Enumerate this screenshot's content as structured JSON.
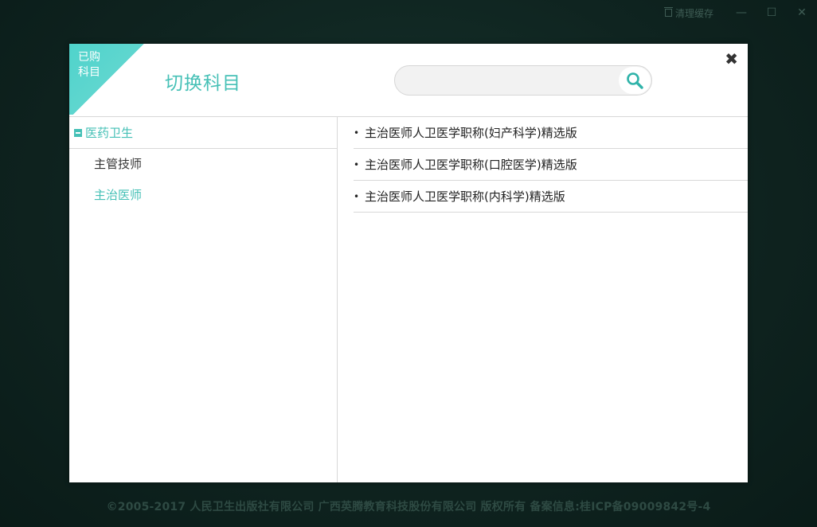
{
  "titlebar": {
    "clear_cache_label": "清理缓存",
    "minimize_glyph": "—",
    "maximize_glyph": "☐",
    "close_glyph": "✕"
  },
  "dialog": {
    "corner_line1": "已购",
    "corner_line2": "科目",
    "title": "切换科目",
    "close_glyph": "✖",
    "search": {
      "value": "",
      "placeholder": "",
      "icon": "search-icon"
    }
  },
  "left_tree": {
    "root_label": "医药卫生",
    "items": [
      {
        "label": "主管技师",
        "active": false
      },
      {
        "label": "主治医师",
        "active": true
      }
    ]
  },
  "courses": [
    {
      "bullet": "•",
      "label": "主治医师人卫医学职称(妇产科学)精选版"
    },
    {
      "bullet": "•",
      "label": "主治医师人卫医学职称(口腔医学)精选版"
    },
    {
      "bullet": "•",
      "label": "主治医师人卫医学职称(内科学)精选版"
    }
  ],
  "footer": {
    "text": "©2005-2017  人民卫生出版社有限公司 广西英腾教育科技股份有限公司  版权所有  备案信息:桂ICP备09009842号-4"
  },
  "colors": {
    "accent": "#45c0b6",
    "corner": "#5fd6cf",
    "background": "#0f2420"
  }
}
